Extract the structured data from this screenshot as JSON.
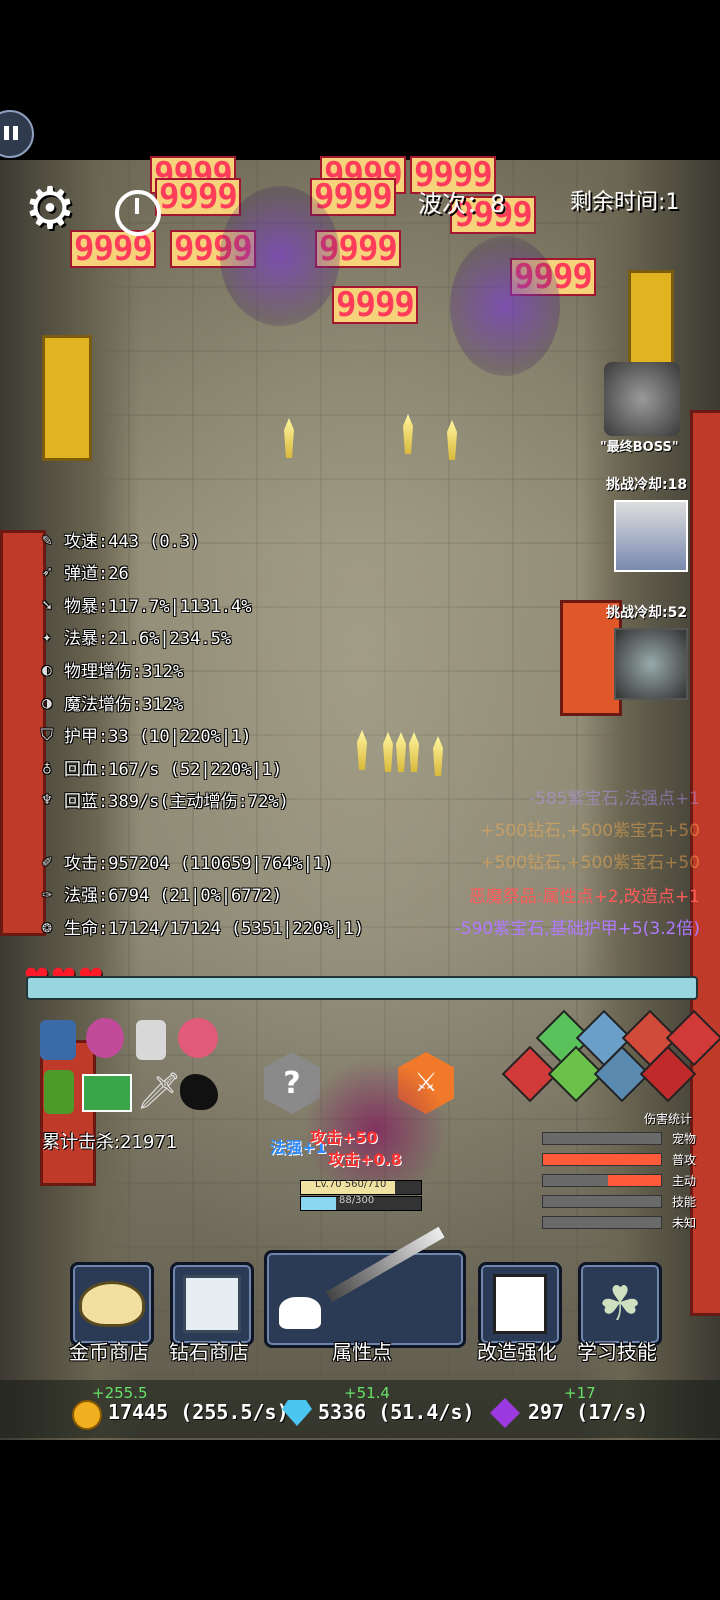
{
  "hud": {
    "wave_label": "波次：8",
    "time_label": "剩余时间:1",
    "damage_nine": "9999"
  },
  "boss": {
    "final_label": "\"最终BOSS\"",
    "challenge1": "挑战冷却:18",
    "challenge2": "挑战冷却:52"
  },
  "stats": [
    {
      "icon": "attack-speed-icon",
      "text": "攻速:443 (0.3)"
    },
    {
      "icon": "trajectory-icon",
      "text": "弹道:26"
    },
    {
      "icon": "phys-crit-icon",
      "text": "物暴:117.7%|1131.4%"
    },
    {
      "icon": "magic-crit-icon",
      "text": "法暴:21.6%|234.5%"
    },
    {
      "icon": "phys-dmg-icon",
      "text": "物理增伤:312%"
    },
    {
      "icon": "magic-dmg-icon",
      "text": "魔法增伤:312%"
    },
    {
      "icon": "armor-icon",
      "text": "护甲:33 (10|220%|1)"
    },
    {
      "icon": "hp-regen-icon",
      "text": "回血:167/s (52|220%|1)"
    },
    {
      "icon": "mp-regen-icon",
      "text": "回蓝:389/s(主动增伤:72%)"
    }
  ],
  "stats2": [
    {
      "icon": "attack-icon",
      "text": "攻击:957204 (110659|764%|1)"
    },
    {
      "icon": "magic-power-icon",
      "text": "法强:6794 (21|0%|6772)"
    },
    {
      "icon": "life-icon",
      "text": "生命:17124/17124 (5351|220%|1)"
    }
  ],
  "log": {
    "line1": "-585紫宝石,法强点+1",
    "line2": "+500钻石,+500紫宝石+50",
    "line3": "+500钻石,+500紫宝石+50",
    "line4": "恶魔祭品:属性点+2,改造点+1",
    "line5": "-590紫宝石,基础护甲+5(3.2倍)"
  },
  "kills": "累计击杀:21971",
  "player": {
    "level": "Lv.70 560/710",
    "mana": "88/300",
    "float1": "法强+1",
    "float2": "攻击+50",
    "float3": "攻击+0.8"
  },
  "damage_stats": {
    "title": "伤害统计",
    "rows": [
      {
        "label": "宠物",
        "fill": 0.0
      },
      {
        "label": "普攻",
        "fill": 1.0
      },
      {
        "label": "主动",
        "fill": 0.45
      },
      {
        "label": "技能",
        "fill": 0.0
      },
      {
        "label": "未知",
        "fill": 0.0
      }
    ]
  },
  "buttons": {
    "gold_shop": "金币商店",
    "diamond_shop": "钻石商店",
    "attr_points": "属性点",
    "reform": "改造强化",
    "learn_skill": "学习技能"
  },
  "resources": {
    "gold": "17445 (255.5/s)",
    "gold_delta": "+255.5",
    "diamond": "5336 (51.4/s)",
    "diamond_delta": "+51.4",
    "gem": "297 (17/s)",
    "gem_delta": "+17"
  },
  "hearts": 3
}
